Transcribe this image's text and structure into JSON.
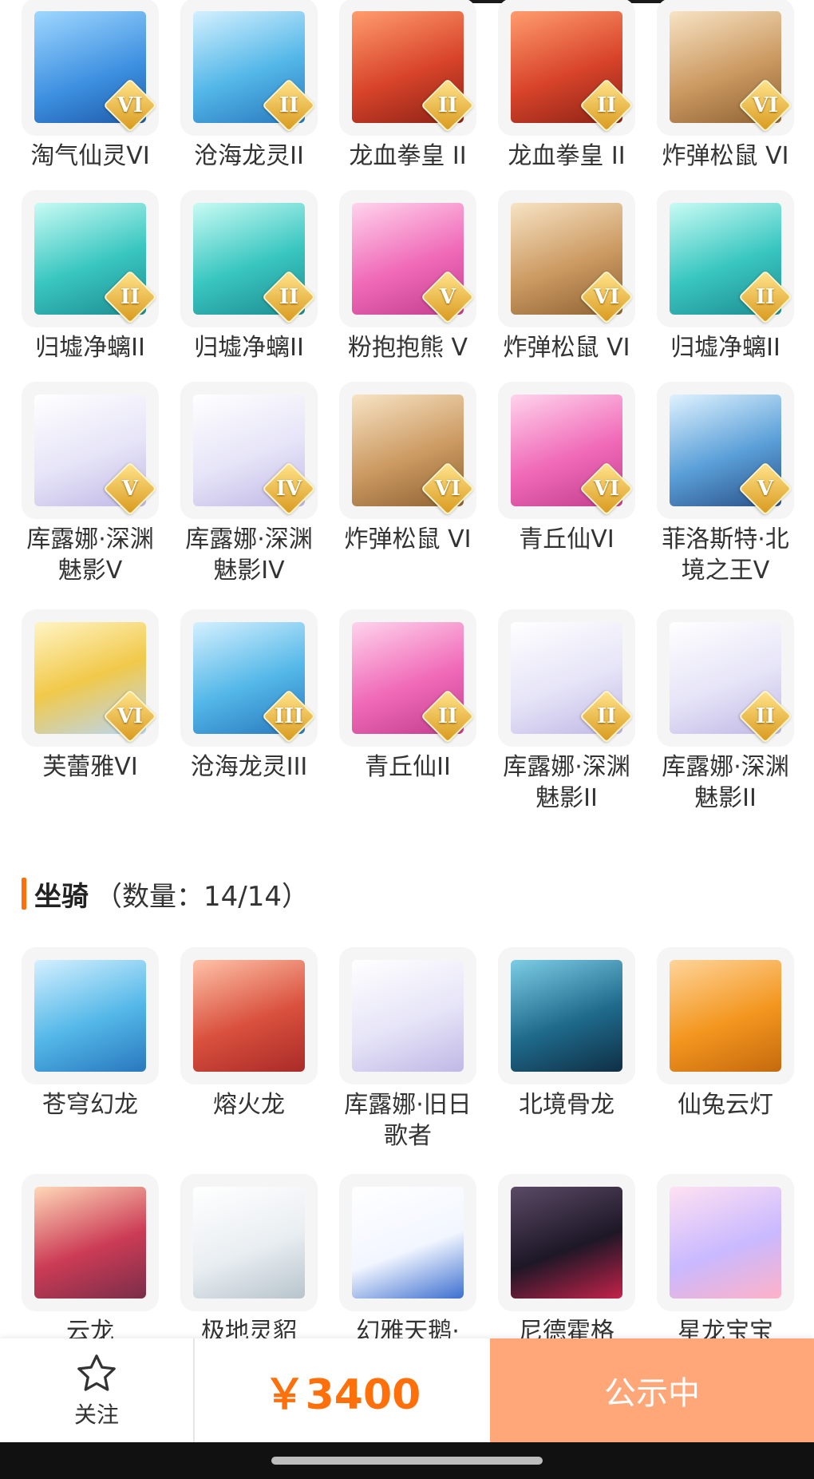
{
  "pets_grid": [
    {
      "name": "淘气仙灵VI",
      "rank": "VI",
      "art": "blue"
    },
    {
      "name": "沧海龙灵II",
      "rank": "II",
      "art": "cyan"
    },
    {
      "name": "龙血拳皇 II",
      "rank": "II",
      "art": "red"
    },
    {
      "name": "龙血拳皇 II",
      "rank": "II",
      "art": "red"
    },
    {
      "name": "炸弹松鼠 VI",
      "rank": "VI",
      "art": "tan"
    },
    {
      "name": "归墟净螭II",
      "rank": "II",
      "art": "teal"
    },
    {
      "name": "归墟净螭II",
      "rank": "II",
      "art": "teal"
    },
    {
      "name": "粉抱抱熊 V",
      "rank": "V",
      "art": "pink"
    },
    {
      "name": "炸弹松鼠 VI",
      "rank": "VI",
      "art": "tan"
    },
    {
      "name": "归墟净螭II",
      "rank": "II",
      "art": "teal"
    },
    {
      "name": "库露娜·深渊魅影V",
      "rank": "V",
      "art": "pale"
    },
    {
      "name": "库露娜·深渊魅影IV",
      "rank": "IV",
      "art": "pale"
    },
    {
      "name": "炸弹松鼠 VI",
      "rank": "VI",
      "art": "tan"
    },
    {
      "name": "青丘仙VI",
      "rank": "VI",
      "art": "pink"
    },
    {
      "name": "菲洛斯特·北境之王V",
      "rank": "V",
      "art": "ice"
    },
    {
      "name": "芙蕾雅VI",
      "rank": "VI",
      "art": "gold"
    },
    {
      "name": "沧海龙灵III",
      "rank": "III",
      "art": "cyan"
    },
    {
      "name": "青丘仙II",
      "rank": "II",
      "art": "pink"
    },
    {
      "name": "库露娜·深渊魅影II",
      "rank": "II",
      "art": "pale"
    },
    {
      "name": "库露娜·深渊魅影II",
      "rank": "II",
      "art": "pale"
    }
  ],
  "mounts_section": {
    "title": "坐骑",
    "count": "（数量：14/14）"
  },
  "mounts_grid": [
    {
      "name": "苍穹幻龙",
      "art": "cyan"
    },
    {
      "name": "熔火龙",
      "art": "crim"
    },
    {
      "name": "库露娜·旧日歌者",
      "art": "pale"
    },
    {
      "name": "北境骨龙",
      "art": "navy"
    },
    {
      "name": "仙兔云灯",
      "art": "orange"
    },
    {
      "name": "云龙",
      "art": "dragon"
    },
    {
      "name": "极地灵貂",
      "art": "white"
    },
    {
      "name": "幻雅天鹅·",
      "art": "swan"
    },
    {
      "name": "尼德霍格",
      "art": "black"
    },
    {
      "name": "星龙宝宝",
      "art": "pastel"
    }
  ],
  "bottom_bar": {
    "follow_label": "关注",
    "price": "￥3400",
    "status_button": "公示中"
  },
  "icons": {
    "follow": "star-outline-icon"
  },
  "colors": {
    "accent": "#ff6f0a",
    "status_button_bg": "#ffa778",
    "tile_bg": "#f5f5f5"
  }
}
